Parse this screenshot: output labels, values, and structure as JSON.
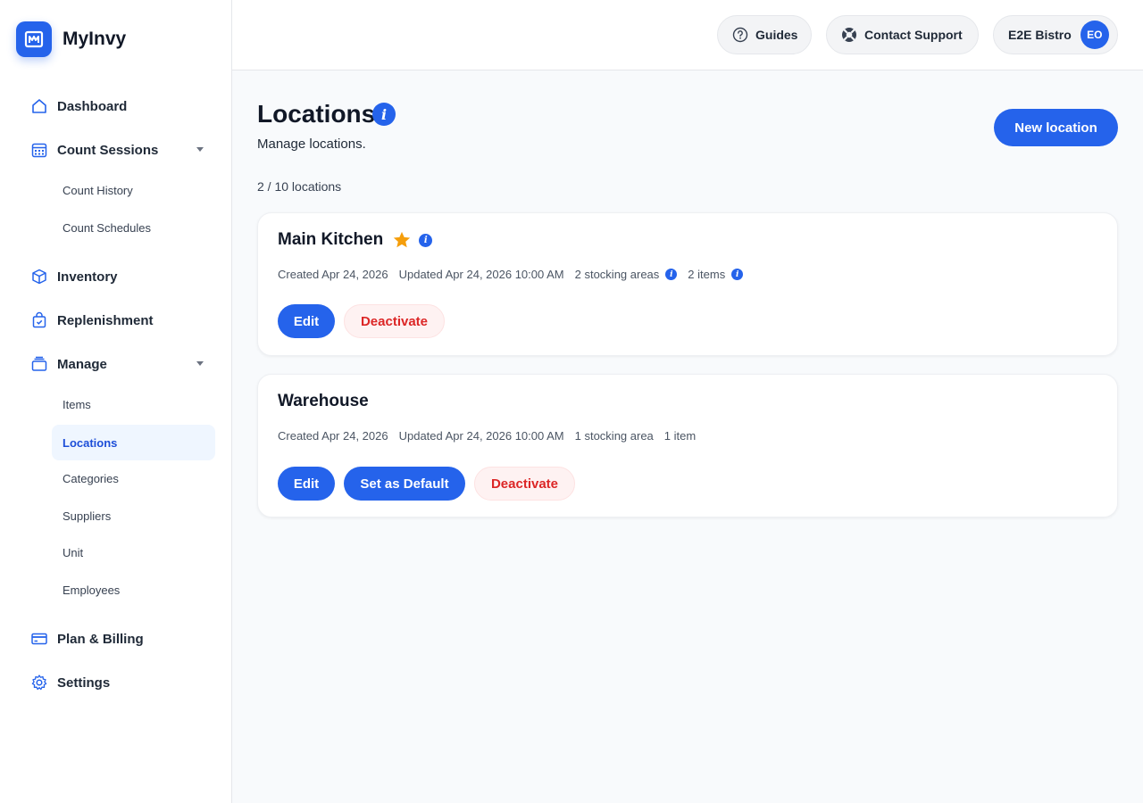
{
  "app": {
    "name": "MyInvy"
  },
  "sidebar": {
    "items": [
      {
        "label": "Dashboard",
        "icon": "home-icon"
      },
      {
        "label": "Count Sessions",
        "icon": "calendar-icon"
      },
      {
        "label": "Inventory",
        "icon": "box-icon"
      },
      {
        "label": "Replenishment",
        "icon": "bag-check-icon"
      },
      {
        "label": "Manage",
        "icon": "stack-icon"
      },
      {
        "label": "Plan & Billing",
        "icon": "credit-card-icon"
      },
      {
        "label": "Settings",
        "icon": "gear-icon"
      }
    ],
    "count_sub": [
      "Count History",
      "Count Schedules"
    ],
    "manage_sub": [
      "Items",
      "Locations",
      "Categories",
      "Suppliers",
      "Unit",
      "Employees"
    ],
    "active": "Locations"
  },
  "topbar": {
    "guides": "Guides",
    "support": "Contact Support",
    "org": "E2E Bistro",
    "avatar_initials": "EO"
  },
  "page": {
    "title": "Locations",
    "subtitle": "Manage locations.",
    "count": "2 / 10 locations",
    "new_button": "New location"
  },
  "locations": [
    {
      "name": "Main Kitchen",
      "is_default": true,
      "created": "Created Apr 24, 2026",
      "updated": "Updated Apr 24, 2026 10:00 AM",
      "stocking": "2 stocking areas",
      "items": "2 items",
      "edit": "Edit",
      "deactivate": "Deactivate"
    },
    {
      "name": "Warehouse",
      "is_default": false,
      "created": "Created Apr 24, 2026",
      "updated": "Updated Apr 24, 2026 10:00 AM",
      "stocking": "1 stocking area",
      "items": "1 item",
      "edit": "Edit",
      "set_default": "Set as Default",
      "deactivate": "Deactivate"
    }
  ],
  "colors": {
    "accent": "#2563eb",
    "danger": "#dc2626",
    "star": "#f59e0b"
  }
}
